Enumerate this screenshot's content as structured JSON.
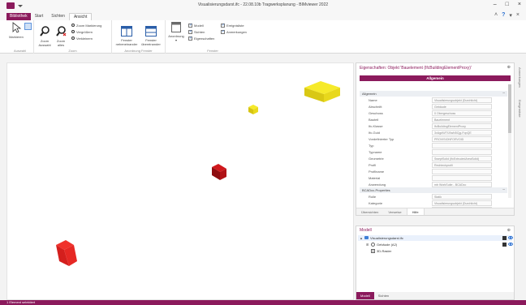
{
  "window": {
    "title": "Visualisierungsdarst.ifc - 22.08.10b Tragwerksplanung - BIMviewer 2022",
    "controls": [
      "–",
      "□",
      "×"
    ]
  },
  "ribbon": {
    "file_tab": "Bibliothek",
    "tabs": [
      "Start",
      "Sichten",
      "Ansicht"
    ],
    "active_tab": "Ansicht",
    "help": "?",
    "groups": {
      "auswahl": {
        "label": "Auswahl",
        "markieren": "Markieren"
      },
      "zoom": {
        "label": "Zoom",
        "zoom_auswahl": "Zoom\nAuswahl",
        "zoom_alles": "Zoom\nalles",
        "zoom_markierung": "Zoom Markierung",
        "vergroessern": "Vergrößern",
        "verkleinern": "Verkleinern"
      },
      "anordnung": {
        "label": "Anordnung Fenster",
        "nebeneinander": "Fenster\nnebeneinander",
        "uebereinander": "Fenster\nübereinander"
      },
      "fenster": {
        "label": "Fenster",
        "anordnung": "Anordnung",
        "checks": [
          {
            "label": "Modell",
            "checked": true
          },
          {
            "label": "Sichten",
            "checked": true
          },
          {
            "label": "Eigenschaften",
            "checked": true
          },
          {
            "label": "Ereignisliste",
            "checked": true
          },
          {
            "label": "Anmerkungen",
            "checked": true
          }
        ]
      }
    }
  },
  "properties": {
    "title": "Eigenschaften: Objekt 'Bauelement (IfcBuildingElementProxy)'",
    "banner": "Allgemein",
    "sections": [
      {
        "name": "Allgemein",
        "rows": [
          {
            "label": "Name",
            "value": "Visualisierungsobjekt (Durchlicht)"
          },
          {
            "label": "Abschnitt",
            "value": "Gebäude"
          },
          {
            "label": "Geschoss",
            "value": "0 Obergeschoss"
          },
          {
            "label": "Bauteil",
            "value": "Bauelement"
          },
          {
            "label": "Ifc-Klasse",
            "value": "IfcBuildingElementProxy"
          },
          {
            "label": "Ifc-Guid",
            "value": "3vAgdWTfJ0wN5Cjg-FopQE"
          },
          {
            "label": "Vordefinierter Typ",
            "value": "PROVISIONFORVOID"
          },
          {
            "label": "Typ",
            "value": ""
          },
          {
            "label": "Typname",
            "value": ""
          },
          {
            "label": "Geometrie",
            "value": "SweptSolid (IfcExtrudedAreaSolid)"
          },
          {
            "label": "Profil",
            "value": "Rechteckprofil"
          },
          {
            "label": "Profilname",
            "value": ""
          },
          {
            "label": "Material",
            "value": ""
          },
          {
            "label": "Anwendung",
            "value": "mb WorkSuite - BCADcc"
          }
        ]
      },
      {
        "name": "BCADcc-Properties",
        "rows": [
          {
            "label": "Rolle",
            "value": "Statik"
          },
          {
            "label": "Kategorie",
            "value": "Visualisierungsobjekt (Durchlicht)"
          },
          {
            "label": "Modellbezeichnung",
            "value": "Architekturmodell in LED Entwurf"
          }
        ]
      }
    ],
    "tabs": [
      "Übersichten",
      "Verweise",
      "Hilfe"
    ],
    "active_tab": "Hilfe"
  },
  "side_tabs": [
    "Anmerkungen",
    "Ereignisliste"
  ],
  "model": {
    "title": "Modell",
    "tree": [
      {
        "label": "Visualisierungsdarst.ifc",
        "level": 0,
        "expander": "▲"
      },
      {
        "label": "Gebäude (A2)",
        "level": 1,
        "expander": "⊞"
      },
      {
        "label": "3D-Raster",
        "level": 1,
        "expander": ""
      }
    ],
    "tabs": [
      "Modell",
      "Sichten"
    ],
    "active_tab": "Modell"
  },
  "status": {
    "text": "1 Element selektiert"
  },
  "colors": {
    "accent": "#8b1a5c",
    "cube_yellow": "#f2e21a",
    "cube_dark_red": "#c0141a",
    "cube_red": "#e8262a"
  }
}
